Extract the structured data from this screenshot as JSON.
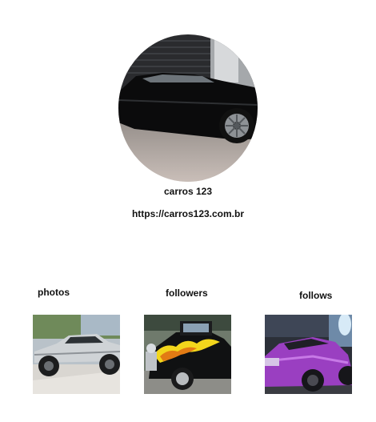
{
  "profile": {
    "name": "carros 123",
    "url": "https://carros123.com.br",
    "avatar_icon": "black-classic-car-photo"
  },
  "stats": {
    "photos_label": "photos",
    "followers_label": "followers",
    "follows_label": "follows"
  },
  "thumbnails": [
    {
      "icon": "silver-lifted-muscle-car-photo"
    },
    {
      "icon": "black-hot-rod-with-flames-photo"
    },
    {
      "icon": "purple-muscle-car-photo"
    }
  ]
}
